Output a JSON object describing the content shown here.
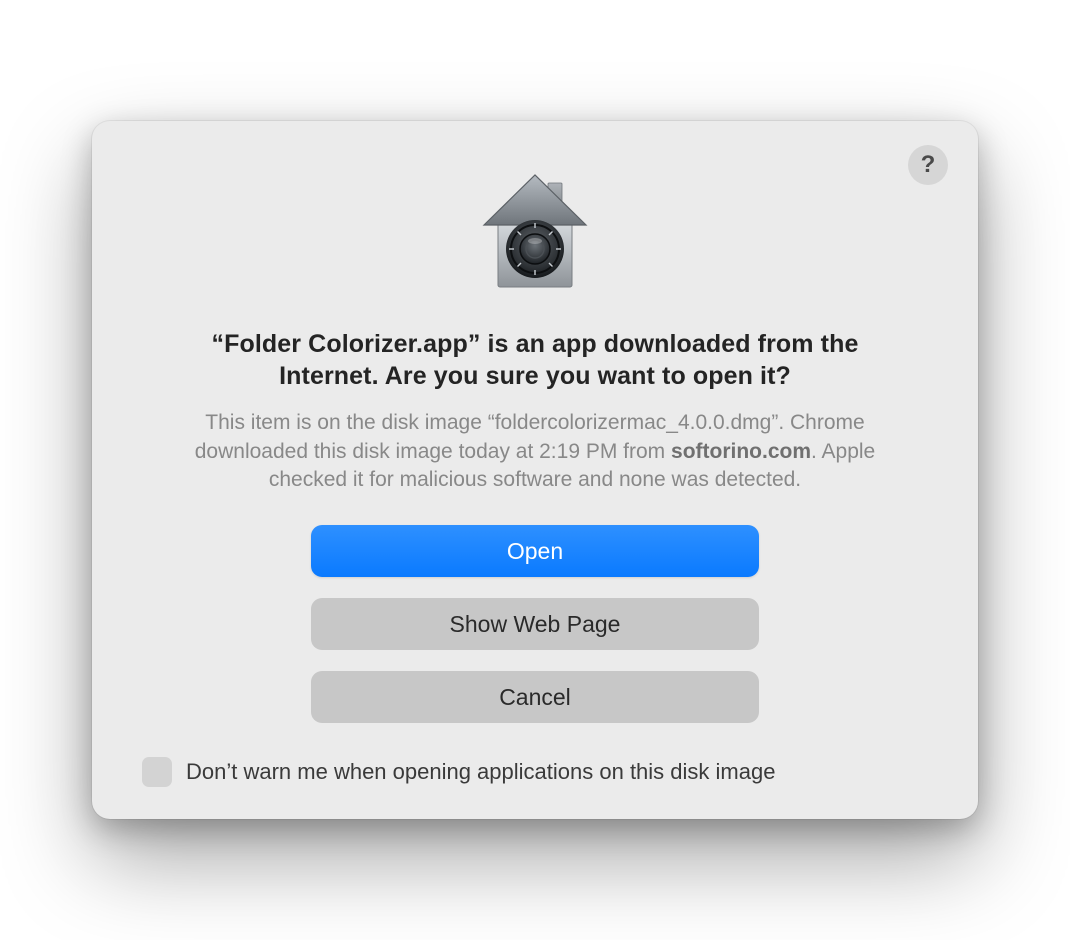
{
  "help_button_label": "?",
  "title": "“Folder Colorizer.app” is an app downloaded from the Internet. Are you sure you want to open it?",
  "body_prefix": "This item is on the disk image “foldercolorizermac_4.0.0.dmg”. Chrome downloaded this disk image today at 2:19 PM from ",
  "body_domain": "softorino.com",
  "body_suffix": ". Apple checked it for malicious software and none was detected.",
  "buttons": {
    "open": "Open",
    "show_web_page": "Show Web Page",
    "cancel": "Cancel"
  },
  "footer_checkbox_label": "Don’t warn me when opening applications on this disk image"
}
